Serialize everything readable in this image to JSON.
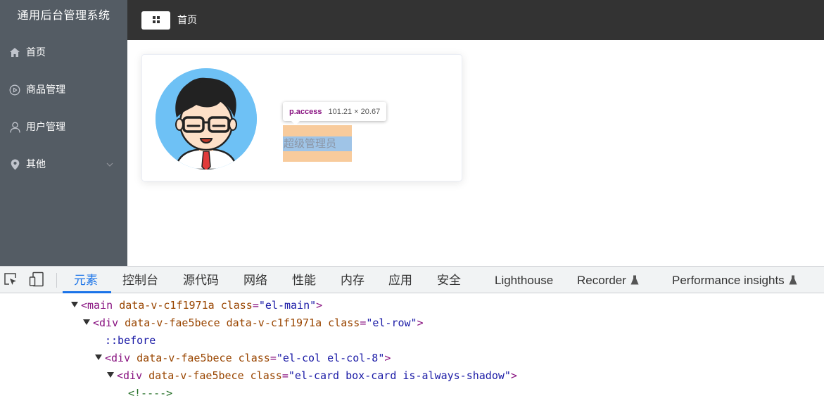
{
  "sidebar": {
    "title": "通用后台管理系统",
    "items": [
      {
        "label": "首页",
        "icon": "home-icon"
      },
      {
        "label": "商品管理",
        "icon": "video-play-icon"
      },
      {
        "label": "用户管理",
        "icon": "user-icon"
      },
      {
        "label": "其他",
        "icon": "location-icon",
        "expandable": true
      }
    ],
    "colors": {
      "bg": "#545c64",
      "text": "#ffffff"
    }
  },
  "header": {
    "menu_icon": "grid-menu-icon",
    "breadcrumb": "首页",
    "bg": "#333333"
  },
  "card": {
    "avatar": "user-avatar-image",
    "access_text": "超级管理员"
  },
  "inspector_tooltip": {
    "selector": "p.access",
    "size": "101.21 × 20.67"
  },
  "devtools": {
    "tabs": [
      {
        "label": "元素",
        "active": true
      },
      {
        "label": "控制台"
      },
      {
        "label": "源代码"
      },
      {
        "label": "网络"
      },
      {
        "label": "性能"
      },
      {
        "label": "内存"
      },
      {
        "label": "应用"
      },
      {
        "label": "安全"
      },
      {
        "label": "Lighthouse"
      },
      {
        "label": "Recorder",
        "icon": "flask-icon"
      },
      {
        "label": "Performance insights",
        "icon": "flask-icon"
      }
    ],
    "accent": "#1a73e8",
    "dom": {
      "l1": {
        "open": "<",
        "tag": "main",
        "a1": "data-v-c1f1971a",
        "a2n": "class",
        "eq": "=",
        "a2v": "\"el-main\"",
        "close": ">"
      },
      "l2": {
        "open": "<",
        "tag": "div",
        "a1": "data-v-fae5bece",
        "a2": "data-v-c1f1971a",
        "a3n": "class",
        "eq": "=",
        "a3v": "\"el-row\"",
        "close": ">"
      },
      "l3": {
        "pseudo": "::before"
      },
      "l4": {
        "open": "<",
        "tag": "div",
        "a1": "data-v-fae5bece",
        "a2n": "class",
        "eq": "=",
        "a2v": "\"el-col el-col-8\"",
        "close": ">"
      },
      "l5": {
        "open": "<",
        "tag": "div",
        "a1": "data-v-fae5bece",
        "a2n": "class",
        "eq": "=",
        "a2v": "\"el-card box-card is-always-shadow\"",
        "close": ">"
      },
      "l6": {
        "comment": "<!---->"
      }
    }
  }
}
